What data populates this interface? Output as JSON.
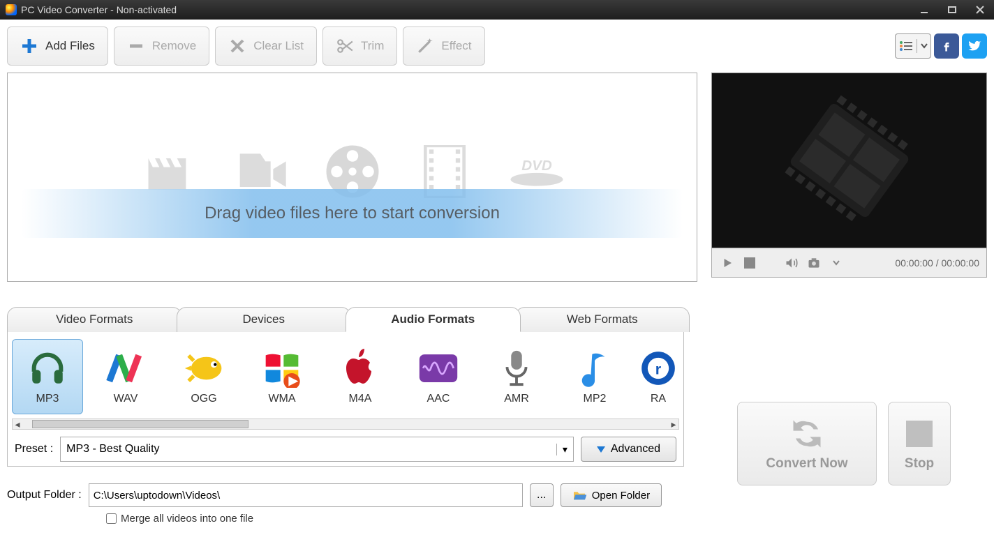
{
  "title": "PC Video Converter - Non-activated",
  "toolbar": {
    "add": "Add Files",
    "remove": "Remove",
    "clear": "Clear List",
    "trim": "Trim",
    "effect": "Effect"
  },
  "dropzone_hint": "Drag video files here to start conversion",
  "player": {
    "time": "00:00:00 / 00:00:00"
  },
  "tabs": [
    "Video Formats",
    "Devices",
    "Audio Formats",
    "Web Formats"
  ],
  "active_tab": "Audio Formats",
  "formats": [
    {
      "id": "MP3",
      "selected": true
    },
    {
      "id": "WAV"
    },
    {
      "id": "OGG"
    },
    {
      "id": "WMA"
    },
    {
      "id": "M4A"
    },
    {
      "id": "AAC"
    },
    {
      "id": "AMR"
    },
    {
      "id": "MP2"
    },
    {
      "id": "RA"
    }
  ],
  "preset": {
    "label": "Preset :",
    "value": "MP3 - Best Quality",
    "advanced": "Advanced"
  },
  "output": {
    "label": "Output Folder :",
    "path": "C:\\Users\\uptodown\\Videos\\",
    "open": "Open Folder"
  },
  "merge": "Merge all videos into one file",
  "actions": {
    "convert": "Convert Now",
    "stop": "Stop"
  }
}
